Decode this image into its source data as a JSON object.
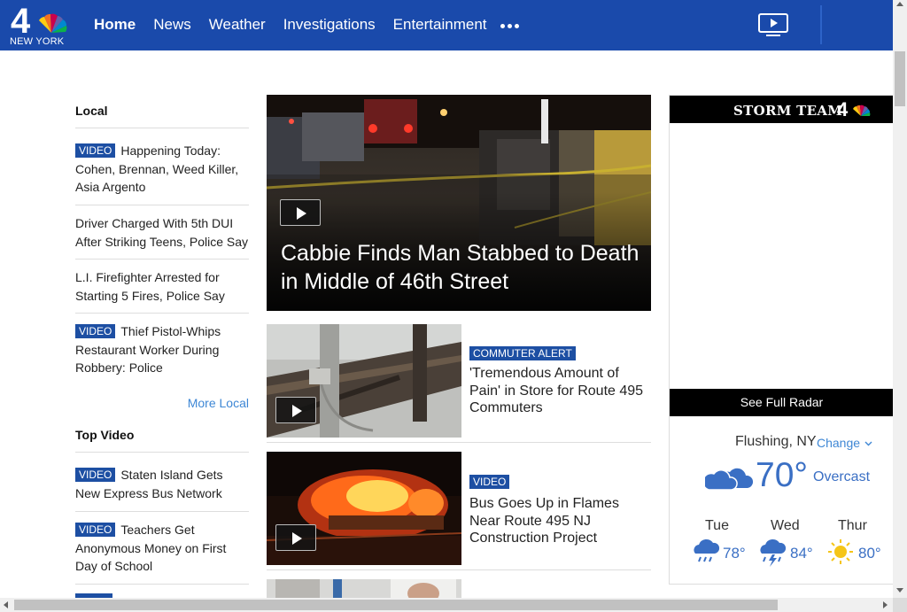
{
  "header": {
    "logo": {
      "number": "4",
      "city": "NEW YORK"
    },
    "nav": [
      {
        "label": "Home",
        "active": true
      },
      {
        "label": "News",
        "active": false
      },
      {
        "label": "Weather",
        "active": false
      },
      {
        "label": "Investigations",
        "active": false
      },
      {
        "label": "Entertainment",
        "active": false
      }
    ],
    "more_icon": "ellipsis-icon",
    "tv_icon": "tv-play-icon",
    "brand_color": "#1a4aab"
  },
  "local": {
    "title": "Local",
    "stories": [
      {
        "badge": "VIDEO",
        "text": "Happening Today: Cohen, Brennan, Weed Killer, Asia Argento"
      },
      {
        "badge": "",
        "text": "Driver Charged With 5th DUI After Striking Teens, Police Say"
      },
      {
        "badge": "",
        "text": "L.I. Firefighter Arrested for Starting 5 Fires, Police Say"
      },
      {
        "badge": "VIDEO",
        "text": "Thief Pistol-Whips Restaurant Worker During Robbery: Police"
      }
    ],
    "more_label": "More Local"
  },
  "top_video": {
    "title": "Top Video",
    "stories": [
      {
        "badge": "VIDEO",
        "text": "Staten Island Gets New Express Bus Network"
      },
      {
        "badge": "VIDEO",
        "text": "Teachers Get Anonymous Money on First Day of School"
      }
    ]
  },
  "hero": {
    "title": "Cabbie Finds Man Stabbed to Death in Middle of 46th Street"
  },
  "cards": [
    {
      "badge": "COMMUTER ALERT",
      "title": "'Tremendous Amount of Pain' in Store for Route 495 Commuters"
    },
    {
      "badge": "VIDEO",
      "title": "Bus Goes Up in Flames Near Route 495 NJ Construction Project"
    }
  ],
  "weather": {
    "brand": "STORM TEAM",
    "brand_number": "4",
    "radar_label": "See Full Radar",
    "location": "Flushing, NY",
    "change_label": "Change",
    "current_temp": "70°",
    "condition": "Overcast",
    "current_icon": "cloudy-icon",
    "forecast": [
      {
        "day": "Tue",
        "temp": "78°",
        "icon": "rain-icon"
      },
      {
        "day": "Wed",
        "temp": "84°",
        "icon": "thunderstorm-icon"
      },
      {
        "day": "Thur",
        "temp": "80°",
        "icon": "sun-icon"
      }
    ]
  }
}
